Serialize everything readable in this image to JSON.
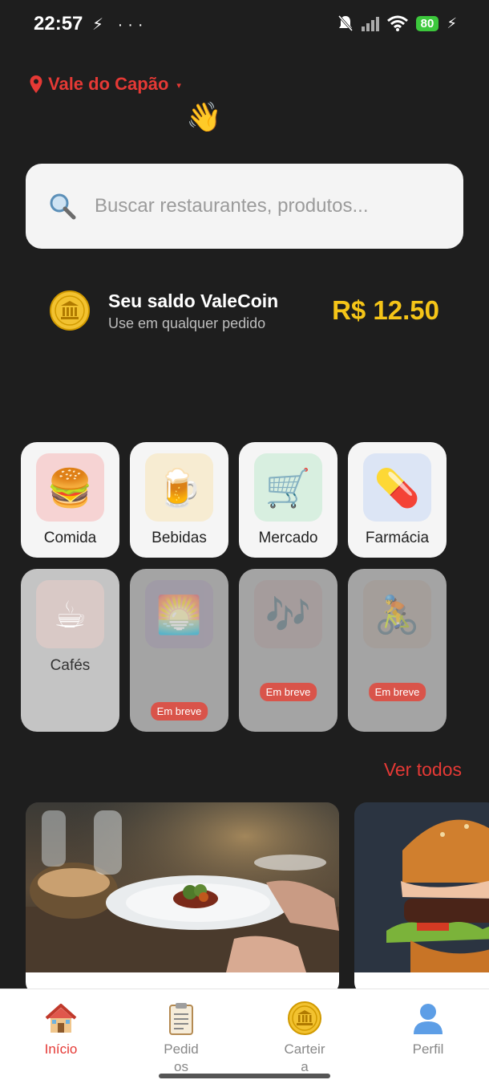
{
  "status": {
    "time": "22:57",
    "left_icons": "⚡ ···",
    "battery": "80",
    "charging": "⚡"
  },
  "location": {
    "label": "Vale do Capão",
    "pin_icon": "pin-icon",
    "caret": "▾"
  },
  "greeting": {
    "emoji": "👋"
  },
  "search": {
    "placeholder": "Buscar restaurantes, produtos...",
    "icon": "search-icon"
  },
  "wallet": {
    "title": "Seu saldo ValeCoin",
    "subtitle": "Use em qualquer pedido",
    "amount": "R$ 12.50",
    "accent": "#f5c518"
  },
  "categories": [
    {
      "label": "Comida",
      "emoji": "🍔",
      "bg": "#f6d3d3"
    },
    {
      "label": "Bebidas",
      "emoji": "🍺",
      "bg": "#f7ecd2"
    },
    {
      "label": "Mercado",
      "emoji": "🛒",
      "bg": "#d8efe0"
    },
    {
      "label": "Farmácia",
      "emoji": "💊",
      "bg": "#dce5f5"
    },
    {
      "label": "Cafés",
      "emoji": "☕",
      "bg": "#d9c9c6"
    },
    {
      "label": "",
      "emoji": "🌅",
      "bg": "#9e94a8",
      "badge": "Em breve"
    },
    {
      "label": "",
      "emoji": "🎶",
      "bg": "#a79697",
      "badge": "Em breve"
    },
    {
      "label": "",
      "emoji": "🚴",
      "bg": "#a59a92",
      "badge": "Em breve"
    }
  ],
  "see_all": "Ver todos",
  "nav": [
    {
      "label": "Início",
      "icon": "home-icon",
      "active": true
    },
    {
      "label": "Pedidos",
      "icon": "clipboard-icon"
    },
    {
      "label": "Carteira",
      "icon": "coin-icon"
    },
    {
      "label": "Perfil",
      "icon": "user-icon"
    }
  ],
  "colors": {
    "brand_red": "#e53935",
    "background": "#1e1e1e"
  }
}
